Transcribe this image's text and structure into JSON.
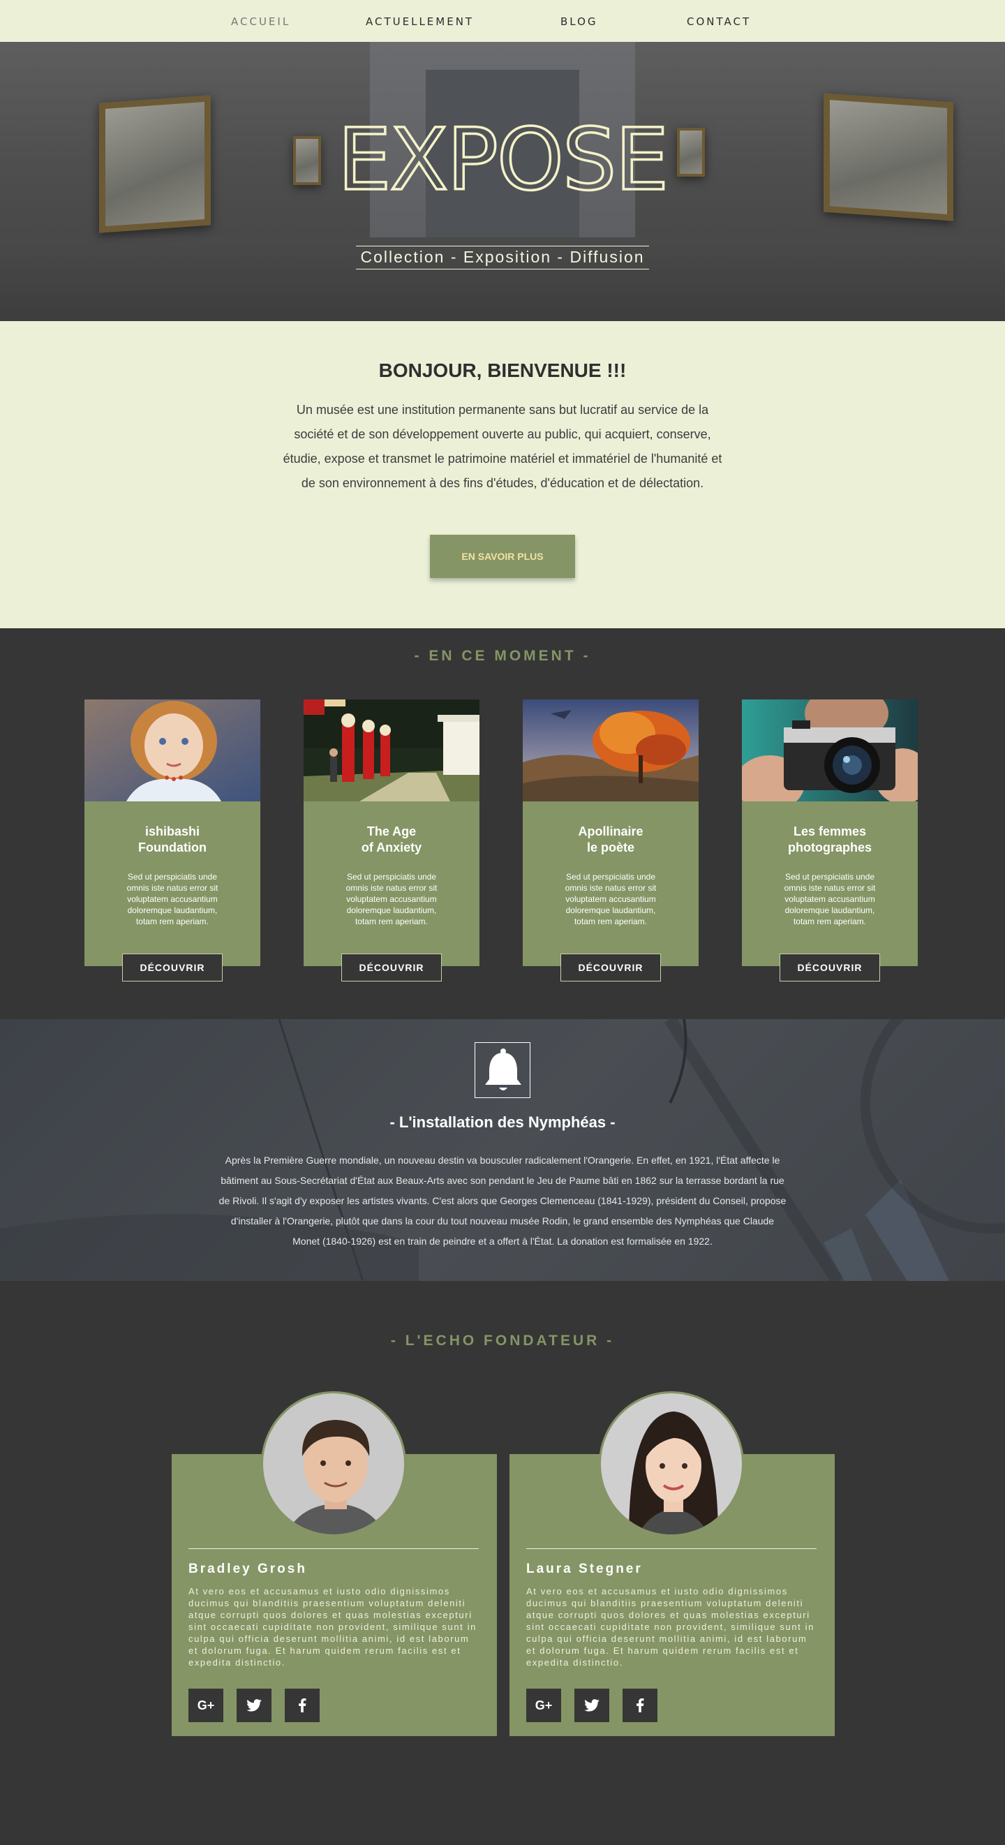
{
  "nav": {
    "items": [
      "ACCUEIL",
      "ACTUELLEMENT",
      "BLOG",
      "CONTACT"
    ]
  },
  "hero": {
    "logo_text": "EXPOSE",
    "tagline": "Collection - Exposition - Diffusion"
  },
  "welcome": {
    "title": "BONJOUR, BIENVENUE !!!",
    "text": "Un musée est une institution permanente sans but lucratif au service de la société et de son développement ouverte au public, qui acquiert, conserve, étudie, expose et transmet le patrimoine matériel et immatériel de l'humanité et de son environnement à des fins d'études, d'éducation et de délectation.",
    "button": "EN SAVOIR PLUS"
  },
  "moment": {
    "title": "- EN CE MOMENT -",
    "cards": [
      {
        "title_1": "ishibashi",
        "title_2": "Foundation",
        "text": "Sed ut perspiciatis unde omnis iste natus error sit voluptatem accusantium doloremque laudantium, totam rem aperiam.",
        "button": "DÉCOUVRIR"
      },
      {
        "title_1": "The Age",
        "title_2": "of Anxiety",
        "text": "Sed ut perspiciatis unde omnis iste natus error sit voluptatem accusantium doloremque laudantium, totam rem aperiam.",
        "button": "DÉCOUVRIR"
      },
      {
        "title_1": "Apollinaire",
        "title_2": "le poète",
        "text": "Sed ut perspiciatis unde omnis iste natus error sit voluptatem accusantium doloremque laudantium, totam rem aperiam.",
        "button": "DÉCOUVRIR"
      },
      {
        "title_1": "Les femmes",
        "title_2": "photographes",
        "text": "Sed ut perspiciatis unde omnis iste natus error sit voluptatem accusantium doloremque laudantium, totam rem aperiam.",
        "button": "DÉCOUVRIR"
      }
    ]
  },
  "nymph": {
    "icon": "bell-icon",
    "title": "- L'installation des Nymphéas -",
    "text": "Après la Première Guerre mondiale, un nouveau destin va bousculer radicalement l'Orangerie. En effet, en 1921, l'État affecte le bâtiment au Sous-Secrétariat d'État aux Beaux-Arts avec son pendant le Jeu de Paume bâti en 1862 sur la terrasse bordant la rue de Rivoli. Il s'agit d'y exposer les artistes vivants. C'est alors que Georges Clemenceau (1841-1929), président du Conseil, propose d'installer à l'Orangerie, plutôt que dans la cour du tout nouveau musée Rodin, le grand ensemble des Nymphéas que Claude Monet (1840-1926) est en train de peindre et a offert à l'État. La donation est formalisée en 1922."
  },
  "echo": {
    "title": "- L'ECHO FONDATEUR -",
    "people": [
      {
        "name": "Bradley Grosh",
        "text": "At vero eos et accusamus et iusto odio dignissimos ducimus qui blanditiis praesentium voluptatum deleniti atque corrupti quos dolores et quas molestias excepturi sint occaecati cupiditate non provident, similique sunt in culpa qui officia deserunt mollitia animi, id est laborum et dolorum fuga. Et harum quidem rerum facilis est et expedita distinctio.",
        "social": [
          "G+",
          "twitter-icon",
          "facebook-icon"
        ]
      },
      {
        "name": "Laura Stegner",
        "text": "At vero eos et accusamus et iusto odio dignissimos ducimus qui blanditiis praesentium voluptatum deleniti atque corrupti quos dolores et quas molestias excepturi sint occaecati cupiditate non provident, similique sunt in culpa qui officia deserunt mollitia animi, id est laborum et dolorum fuga. Et harum quidem rerum facilis est et expedita distinctio.",
        "social": [
          "G+",
          "twitter-icon",
          "facebook-icon"
        ]
      }
    ]
  },
  "colors": {
    "cream": "#ebf0d7",
    "olive": "#859565",
    "dark": "#363636",
    "gold_text": "#f1e3a3"
  }
}
